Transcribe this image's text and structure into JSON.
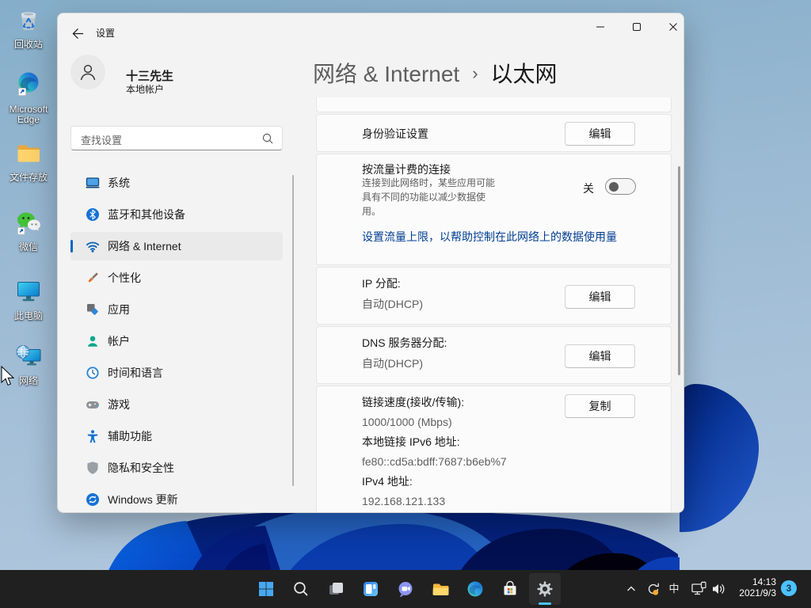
{
  "window": {
    "title": "设置"
  },
  "user": {
    "name": "十三先生",
    "account_type": "本地帐户"
  },
  "search": {
    "placeholder": "查找设置"
  },
  "sidebar": {
    "items": [
      {
        "label": "系统",
        "icon": "system-icon",
        "selected": false
      },
      {
        "label": "蓝牙和其他设备",
        "icon": "bluetooth-icon",
        "selected": false
      },
      {
        "label": "网络 & Internet",
        "icon": "wifi-icon",
        "selected": true
      },
      {
        "label": "个性化",
        "icon": "personalization-icon",
        "selected": false
      },
      {
        "label": "应用",
        "icon": "apps-icon",
        "selected": false
      },
      {
        "label": "帐户",
        "icon": "accounts-icon",
        "selected": false
      },
      {
        "label": "时间和语言",
        "icon": "time-language-icon",
        "selected": false
      },
      {
        "label": "游戏",
        "icon": "gaming-icon",
        "selected": false
      },
      {
        "label": "辅助功能",
        "icon": "accessibility-icon",
        "selected": false
      },
      {
        "label": "隐私和安全性",
        "icon": "privacy-shield-icon",
        "selected": false
      },
      {
        "label": "Windows 更新",
        "icon": "windows-update-icon",
        "selected": false
      }
    ]
  },
  "breadcrumb": {
    "root": "网络 & Internet",
    "separator": "›",
    "current": "以太网"
  },
  "content": {
    "auth": {
      "label": "身份验证设置",
      "button": "编辑"
    },
    "metered": {
      "title": "按流量计费的连接",
      "description": [
        "连接到此网络时，某些应用可能",
        "具有不同的功能以减少数据使",
        "用。"
      ],
      "toggle_label": "关",
      "toggle_state": "off"
    },
    "data_limit_link": "设置流量上限，以帮助控制在此网络上的数据使用量",
    "ip": {
      "label": "IP 分配:",
      "value": "自动(DHCP)",
      "button": "编辑"
    },
    "dns": {
      "label": "DNS 服务器分配:",
      "value": "自动(DHCP)",
      "button": "编辑"
    },
    "details": {
      "button": "复制",
      "lines": [
        {
          "label": "链接速度(接收/传输):",
          "value": "1000/1000 (Mbps)"
        },
        {
          "label": "本地链接 IPv6 地址:",
          "value": "fe80::cd5a:bdff:7687:b6eb%7"
        },
        {
          "label": "IPv4 地址:",
          "value": "192.168.121.133"
        }
      ]
    }
  },
  "desktop": {
    "icons": [
      {
        "label": "回收站",
        "icon": "recycle-bin-icon"
      },
      {
        "label": "Microsoft Edge",
        "icon": "edge-icon"
      },
      {
        "label": "文件存放",
        "icon": "folder-icon"
      },
      {
        "label": "微信",
        "icon": "wechat-icon"
      },
      {
        "label": "此电脑",
        "icon": "this-pc-icon"
      },
      {
        "label": "网络",
        "icon": "network-places-icon"
      }
    ]
  },
  "taskbar": {
    "apps": [
      "start",
      "search",
      "task-view",
      "widgets",
      "chat",
      "file-explorer",
      "edge",
      "store",
      "settings"
    ],
    "active_app": "settings",
    "tray": {
      "ime": "中",
      "time": "14:13",
      "date": "2021/9/3",
      "badge": "3"
    }
  },
  "colors": {
    "accent": "#0067c0",
    "link": "#003e92",
    "taskbar": "#202020",
    "card": "#fbfbfb",
    "window_bg": "#f3f3f3",
    "badge": "#4cc2ff",
    "selected_nav": "#eaeaea"
  }
}
